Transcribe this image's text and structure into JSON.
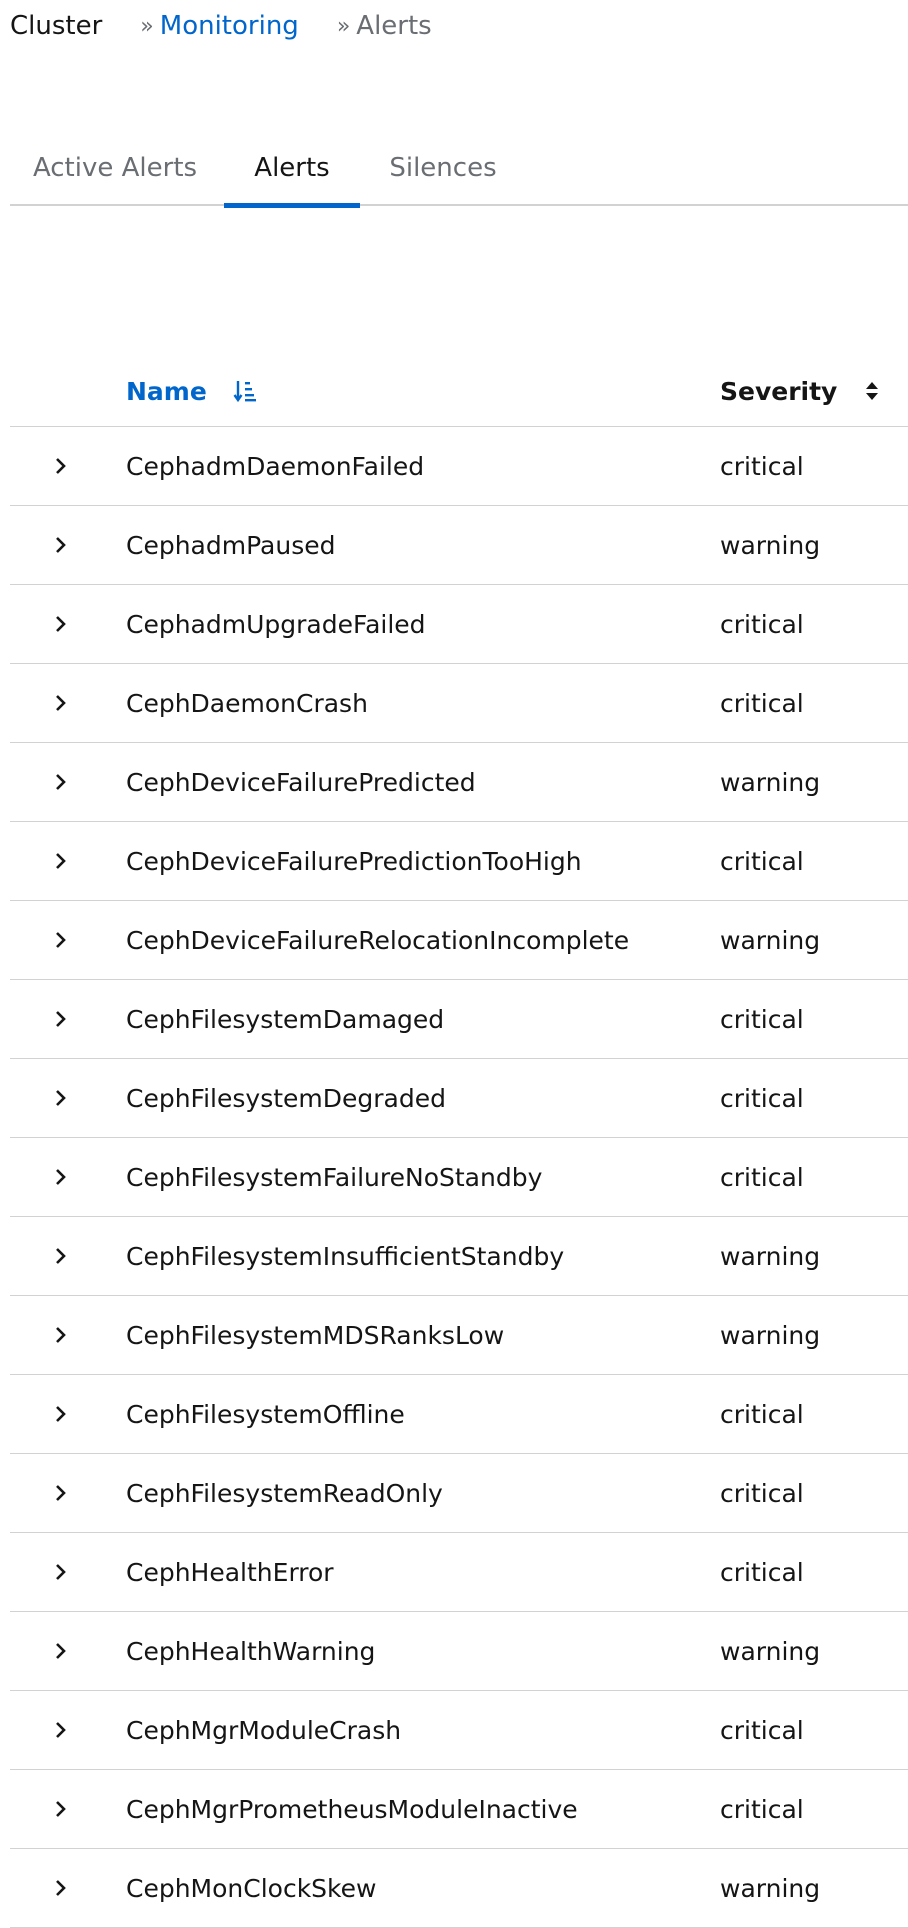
{
  "breadcrumb": {
    "root": "Cluster",
    "link": "Monitoring",
    "current": "Alerts",
    "separator": "»"
  },
  "tabs": [
    {
      "label": "Active Alerts",
      "active": false
    },
    {
      "label": "Alerts",
      "active": true
    },
    {
      "label": "Silences",
      "active": false
    }
  ],
  "table": {
    "columns": {
      "name": "Name",
      "severity": "Severity"
    },
    "sort": {
      "column": "name",
      "direction": "ascending"
    },
    "rows": [
      {
        "name": "CephadmDaemonFailed",
        "severity": "critical"
      },
      {
        "name": "CephadmPaused",
        "severity": "warning"
      },
      {
        "name": "CephadmUpgradeFailed",
        "severity": "critical"
      },
      {
        "name": "CephDaemonCrash",
        "severity": "critical"
      },
      {
        "name": "CephDeviceFailurePredicted",
        "severity": "warning"
      },
      {
        "name": "CephDeviceFailurePredictionTooHigh",
        "severity": "critical"
      },
      {
        "name": "CephDeviceFailureRelocationIncomplete",
        "severity": "warning"
      },
      {
        "name": "CephFilesystemDamaged",
        "severity": "critical"
      },
      {
        "name": "CephFilesystemDegraded",
        "severity": "critical"
      },
      {
        "name": "CephFilesystemFailureNoStandby",
        "severity": "critical"
      },
      {
        "name": "CephFilesystemInsufficientStandby",
        "severity": "warning"
      },
      {
        "name": "CephFilesystemMDSRanksLow",
        "severity": "warning"
      },
      {
        "name": "CephFilesystemOffline",
        "severity": "critical"
      },
      {
        "name": "CephFilesystemReadOnly",
        "severity": "critical"
      },
      {
        "name": "CephHealthError",
        "severity": "critical"
      },
      {
        "name": "CephHealthWarning",
        "severity": "warning"
      },
      {
        "name": "CephMgrModuleCrash",
        "severity": "critical"
      },
      {
        "name": "CephMgrPrometheusModuleInactive",
        "severity": "critical"
      },
      {
        "name": "CephMonClockSkew",
        "severity": "warning"
      }
    ]
  },
  "icons": {
    "expand": "chevron-right-icon",
    "sort_active": "sort-amount-down-icon",
    "sort_inactive": "sort-both-icon"
  },
  "colors": {
    "link": "#0066cc",
    "active_tab_underline": "#0066cc",
    "text": "#151515",
    "muted": "#6a6e73",
    "border": "#d2d2d2"
  }
}
